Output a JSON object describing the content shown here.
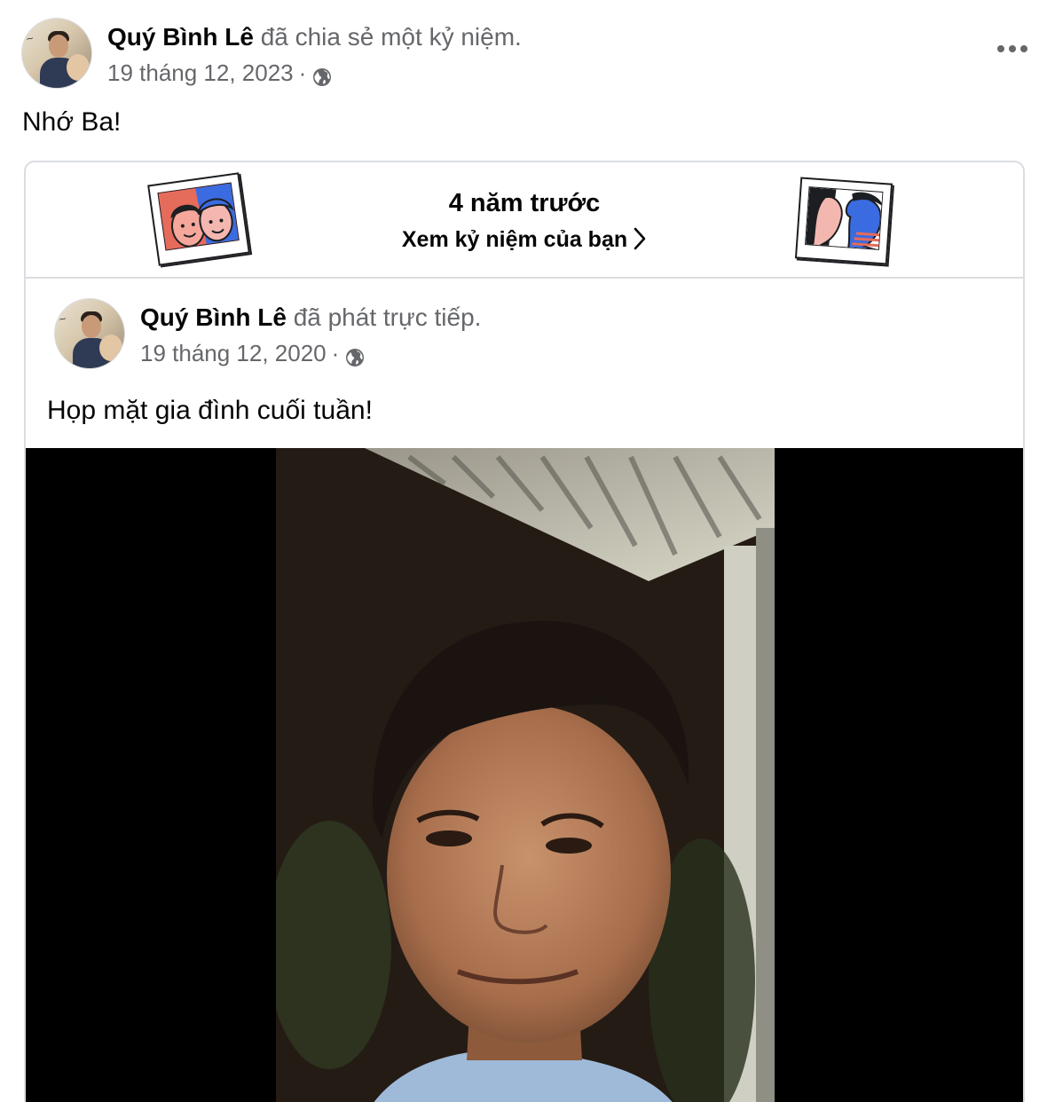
{
  "post": {
    "author_name": "Quý Bình Lê",
    "action": "đã chia sẻ một kỷ niệm.",
    "date": "19 tháng 12, 2023",
    "separator": "·",
    "audience_icon": "globe-icon",
    "more_icon": "more-horizontal-icon",
    "message": "Nhớ Ba!"
  },
  "memory": {
    "years_ago": "4 năm trước",
    "link_label": "Xem kỷ niệm của bạn",
    "link_icon": "chevron-right-icon"
  },
  "shared_post": {
    "author_name": "Quý Bình Lê",
    "action": "đã phát trực tiếp.",
    "date": "19 tháng 12, 2020",
    "separator": "·",
    "audience_icon": "globe-icon",
    "message": "Họp mặt gia đình cuối tuần!"
  },
  "colors": {
    "text_primary": "#050505",
    "text_secondary": "#65676b",
    "border": "#dadde1",
    "video_background": "#000000"
  }
}
